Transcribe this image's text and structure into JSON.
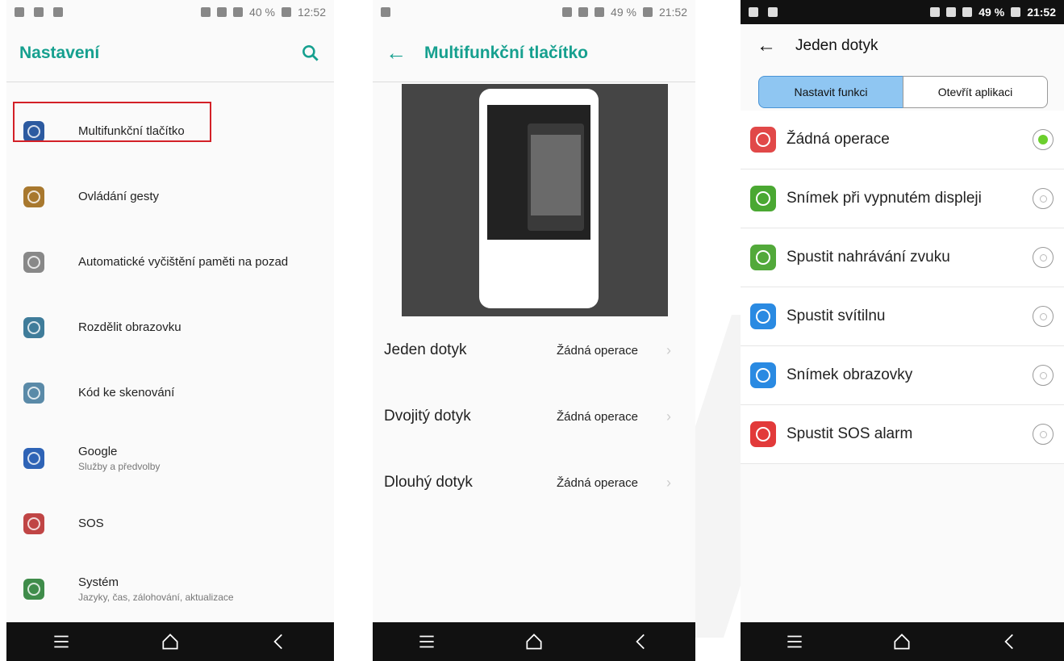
{
  "colors": {
    "accent": "#16a08f",
    "highlight_box": "#d32027",
    "selected_radio": "#6bcf2d",
    "segment_active": "#8fc6f2"
  },
  "screen1": {
    "status": {
      "battery": "40 %",
      "time": "12:52"
    },
    "title": "Nastavení",
    "items": [
      {
        "label": "Multifunkční tlačítko",
        "sub": "",
        "icon": "multifunction-icon",
        "color": "#2c5aa0"
      },
      {
        "label": "Ovládání gesty",
        "sub": "",
        "icon": "gesture-icon",
        "color": "#a8782e"
      },
      {
        "label": "Automatické vyčištění paměti na pozad",
        "sub": "",
        "icon": "broom-icon",
        "color": "#888888"
      },
      {
        "label": "Rozdělit obrazovku",
        "sub": "",
        "icon": "split-screen-icon",
        "color": "#3f7c9a"
      },
      {
        "label": "Kód ke skenování",
        "sub": "",
        "icon": "scan-code-icon",
        "color": "#5a8aa8"
      },
      {
        "label": "Google",
        "sub": "Služby a předvolby",
        "icon": "google-icon",
        "color": "#2e63b6"
      },
      {
        "label": "SOS",
        "sub": "",
        "icon": "sos-icon",
        "color": "#c04545"
      },
      {
        "label": "Systém",
        "sub": "Jazyky, čas, zálohování, aktualizace",
        "icon": "system-icon",
        "color": "#3f8c4a"
      }
    ]
  },
  "screen2": {
    "status": {
      "battery": "49 %",
      "time": "21:52"
    },
    "title": "Multifunkční tlačítko",
    "rows": [
      {
        "label": "Jeden dotyk",
        "value": "Žádná operace"
      },
      {
        "label": "Dvojitý dotyk",
        "value": "Žádná operace"
      },
      {
        "label": "Dlouhý dotyk",
        "value": "Žádná operace"
      }
    ]
  },
  "screen3": {
    "status": {
      "battery": "49 %",
      "time": "21:52"
    },
    "title": "Jeden dotyk",
    "tabs": {
      "active": "Nastavit funkci",
      "inactive": "Otevřít aplikaci"
    },
    "options": [
      {
        "label": "Žádná operace",
        "icon": "no-operation-icon",
        "color": "#e14848",
        "selected": true
      },
      {
        "label": "Snímek při vypnutém displeji",
        "icon": "camera-icon",
        "color": "#4aa832",
        "selected": false
      },
      {
        "label": "Spustit nahrávání zvuku",
        "icon": "audio-record-icon",
        "color": "#52a93a",
        "selected": false
      },
      {
        "label": "Spustit svítilnu",
        "icon": "flashlight-icon",
        "color": "#2a8ae2",
        "selected": false
      },
      {
        "label": "Snímek obrazovky",
        "icon": "screenshot-icon",
        "color": "#2a8ae2",
        "selected": false
      },
      {
        "label": "Spustit SOS alarm",
        "icon": "sos-alarm-icon",
        "color": "#e23a3a",
        "selected": false
      }
    ]
  }
}
